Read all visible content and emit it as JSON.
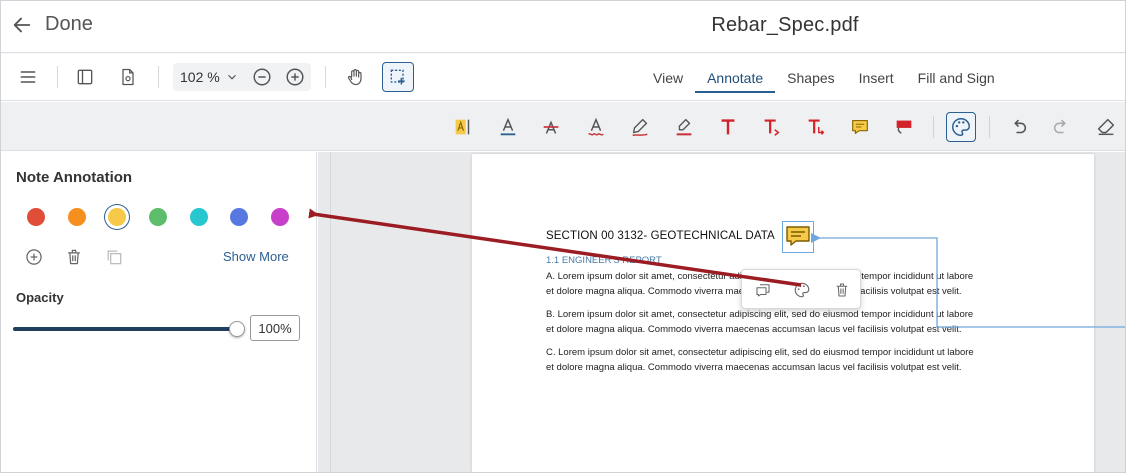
{
  "header": {
    "back_label": "Done",
    "title": "Rebar_Spec.pdf"
  },
  "toolbar": {
    "zoom_value": "102",
    "zoom_unit": "%",
    "tabs": [
      {
        "label": "View"
      },
      {
        "label": "Annotate"
      },
      {
        "label": "Shapes"
      },
      {
        "label": "Insert"
      },
      {
        "label": "Fill and Sign"
      }
    ],
    "active_tab": "Annotate"
  },
  "annotate_tools": [
    "highlight-text-icon",
    "text-color-icon",
    "strikethrough-icon",
    "squiggly-icon",
    "pen-icon",
    "highlighter-icon",
    "free-text-icon",
    "insert-text-icon",
    "replace-text-icon",
    "note-icon",
    "stamp-icon",
    "palette-icon",
    "undo-icon",
    "redo-icon",
    "eraser-icon"
  ],
  "panel": {
    "title": "Note Annotation",
    "colors": [
      "#e04e3a",
      "#f5901e",
      "#f7c948",
      "#5cbd6a",
      "#28c7cf",
      "#5678e0",
      "#c83fc9"
    ],
    "selected_color": "#f7c948",
    "show_more": "Show More",
    "opacity_label": "Opacity",
    "opacity_value": "100%",
    "opacity": 1.0
  },
  "document": {
    "section_title": "SECTION 00 3132- GEOTECHNICAL DATA",
    "subsection": "1.1 ENGINEER'S REPORT",
    "paragraphs": [
      {
        "line1": "A. Lorem ipsum dolor sit amet, consectetur adipiscing elit, sed do eiusmod tempor incididunt ut labore",
        "line2": "et dolore magna aliqua. Commodo viverra maecenas accumsan lacus vel facilisis volutpat est velit."
      },
      {
        "line1": "B. Lorem ipsum dolor sit amet, consectetur adipiscing elit, sed do eiusmod tempor incididunt ut labore",
        "line2": "et dolore magna aliqua. Commodo viverra maecenas accumsan lacus vel facilisis volutpat est velit."
      },
      {
        "line1": "C. Lorem ipsum dolor sit amet, consectetur adipiscing elit, sed do eiusmod tempor incididunt ut labore",
        "line2": "et dolore magna aliqua. Commodo viverra maecenas accumsan lacus vel facilisis volutpat est velit."
      }
    ]
  },
  "colors": {
    "accent": "#2c5f91",
    "note_fill": "#f7c948",
    "callout_arrow": "#9b1c22",
    "connector": "#6fa8dc"
  }
}
